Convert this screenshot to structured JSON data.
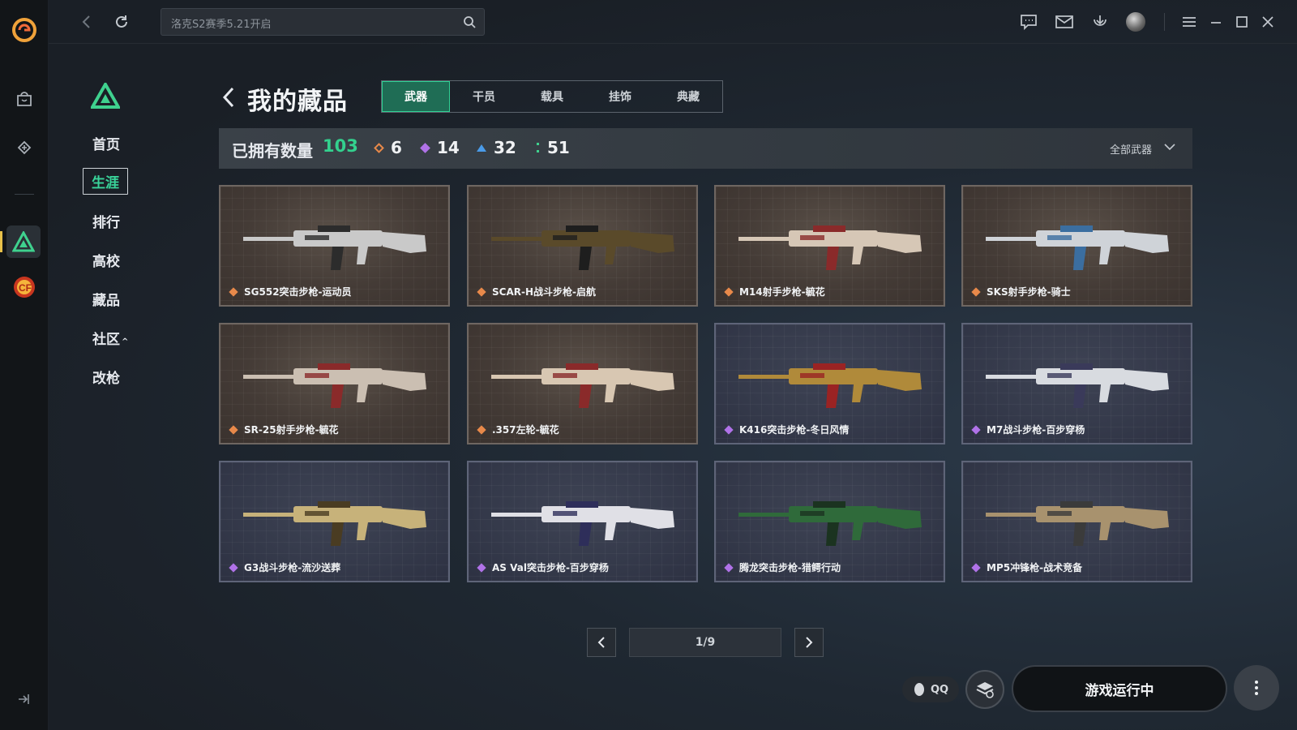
{
  "search": {
    "placeholder": "洛克S2赛季5.21开启"
  },
  "sidebar": {
    "items": [
      {
        "label": "首页"
      },
      {
        "label": "生涯"
      },
      {
        "label": "排行"
      },
      {
        "label": "高校"
      },
      {
        "label": "藏品"
      },
      {
        "label": "社区"
      },
      {
        "label": "改枪"
      }
    ]
  },
  "header": {
    "title": "我的藏品",
    "tabs": [
      {
        "label": "武器"
      },
      {
        "label": "干员"
      },
      {
        "label": "载具"
      },
      {
        "label": "挂饰"
      },
      {
        "label": "典藏"
      }
    ]
  },
  "stats": {
    "label": "已拥有数量",
    "total": "103",
    "rarities": [
      {
        "count": "6",
        "color": "#e8894a"
      },
      {
        "count": "14",
        "color": "#b072e8"
      },
      {
        "count": "32",
        "color": "#4a9be8"
      },
      {
        "count": "51",
        "color": "#3fd18e"
      }
    ],
    "filter": "全部武器"
  },
  "items": [
    {
      "name": "SG552突击步枪-运动员",
      "rarity": "orange"
    },
    {
      "name": "SCAR-H战斗步枪-启航",
      "rarity": "orange"
    },
    {
      "name": "M14射手步枪-毓花",
      "rarity": "orange"
    },
    {
      "name": "SKS射手步枪-骑士",
      "rarity": "orange"
    },
    {
      "name": "SR-25射手步枪-毓花",
      "rarity": "orange"
    },
    {
      "name": ".357左轮-毓花",
      "rarity": "orange"
    },
    {
      "name": "K416突击步枪-冬日风情",
      "rarity": "purple"
    },
    {
      "name": "M7战斗步枪-百步穿杨",
      "rarity": "purple"
    },
    {
      "name": "G3战斗步枪-流沙送葬",
      "rarity": "purple"
    },
    {
      "name": "AS Val突击步枪-百步穿杨",
      "rarity": "purple"
    },
    {
      "name": "腾龙突击步枪-猎鳄行动",
      "rarity": "purple"
    },
    {
      "name": "MP5冲锋枪-战术竞备",
      "rarity": "purple"
    }
  ],
  "pagination": {
    "label": "1/9"
  },
  "bottom": {
    "qq_label": "QQ",
    "run_label": "游戏运行中"
  },
  "colors": {
    "accent": "#33d18e",
    "orange": "#e8894a",
    "purple": "#b072e8"
  }
}
